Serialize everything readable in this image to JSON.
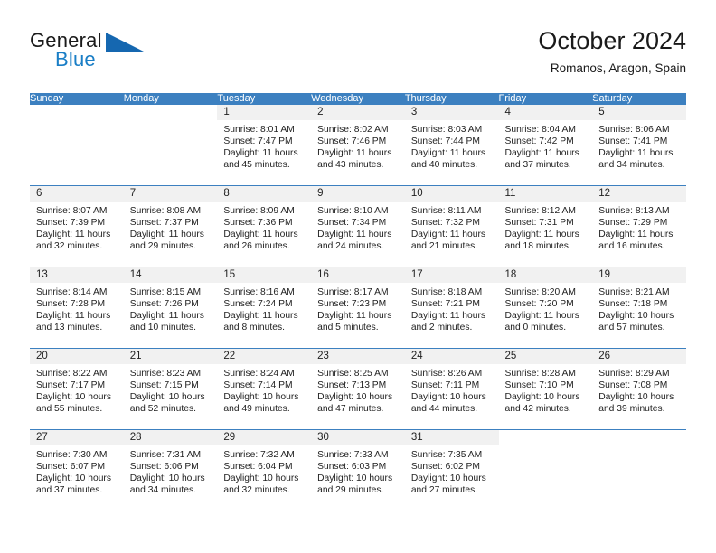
{
  "brand": {
    "line1": "General",
    "line2": "Blue",
    "triangle_color": "#1567b0",
    "blue_color": "#1a7ec6"
  },
  "header": {
    "title": "October 2024",
    "subtitle": "Romanos, Aragon, Spain"
  },
  "theme": {
    "header_bg": "#3c80c0",
    "daynum_bg": "#f1f1f1",
    "separator": "#3c80c0"
  },
  "calendar": {
    "weekday_headers": [
      "Sunday",
      "Monday",
      "Tuesday",
      "Wednesday",
      "Thursday",
      "Friday",
      "Saturday"
    ],
    "weeks": [
      [
        {
          "day": "",
          "sunrise": "",
          "sunset": "",
          "daylight_line1": "",
          "daylight_line2": "",
          "blank": true
        },
        {
          "day": "",
          "sunrise": "",
          "sunset": "",
          "daylight_line1": "",
          "daylight_line2": "",
          "blank": true
        },
        {
          "day": "1",
          "sunrise": "Sunrise: 8:01 AM",
          "sunset": "Sunset: 7:47 PM",
          "daylight_line1": "Daylight: 11 hours",
          "daylight_line2": "and 45 minutes."
        },
        {
          "day": "2",
          "sunrise": "Sunrise: 8:02 AM",
          "sunset": "Sunset: 7:46 PM",
          "daylight_line1": "Daylight: 11 hours",
          "daylight_line2": "and 43 minutes."
        },
        {
          "day": "3",
          "sunrise": "Sunrise: 8:03 AM",
          "sunset": "Sunset: 7:44 PM",
          "daylight_line1": "Daylight: 11 hours",
          "daylight_line2": "and 40 minutes."
        },
        {
          "day": "4",
          "sunrise": "Sunrise: 8:04 AM",
          "sunset": "Sunset: 7:42 PM",
          "daylight_line1": "Daylight: 11 hours",
          "daylight_line2": "and 37 minutes."
        },
        {
          "day": "5",
          "sunrise": "Sunrise: 8:06 AM",
          "sunset": "Sunset: 7:41 PM",
          "daylight_line1": "Daylight: 11 hours",
          "daylight_line2": "and 34 minutes."
        }
      ],
      [
        {
          "day": "6",
          "sunrise": "Sunrise: 8:07 AM",
          "sunset": "Sunset: 7:39 PM",
          "daylight_line1": "Daylight: 11 hours",
          "daylight_line2": "and 32 minutes."
        },
        {
          "day": "7",
          "sunrise": "Sunrise: 8:08 AM",
          "sunset": "Sunset: 7:37 PM",
          "daylight_line1": "Daylight: 11 hours",
          "daylight_line2": "and 29 minutes."
        },
        {
          "day": "8",
          "sunrise": "Sunrise: 8:09 AM",
          "sunset": "Sunset: 7:36 PM",
          "daylight_line1": "Daylight: 11 hours",
          "daylight_line2": "and 26 minutes."
        },
        {
          "day": "9",
          "sunrise": "Sunrise: 8:10 AM",
          "sunset": "Sunset: 7:34 PM",
          "daylight_line1": "Daylight: 11 hours",
          "daylight_line2": "and 24 minutes."
        },
        {
          "day": "10",
          "sunrise": "Sunrise: 8:11 AM",
          "sunset": "Sunset: 7:32 PM",
          "daylight_line1": "Daylight: 11 hours",
          "daylight_line2": "and 21 minutes."
        },
        {
          "day": "11",
          "sunrise": "Sunrise: 8:12 AM",
          "sunset": "Sunset: 7:31 PM",
          "daylight_line1": "Daylight: 11 hours",
          "daylight_line2": "and 18 minutes."
        },
        {
          "day": "12",
          "sunrise": "Sunrise: 8:13 AM",
          "sunset": "Sunset: 7:29 PM",
          "daylight_line1": "Daylight: 11 hours",
          "daylight_line2": "and 16 minutes."
        }
      ],
      [
        {
          "day": "13",
          "sunrise": "Sunrise: 8:14 AM",
          "sunset": "Sunset: 7:28 PM",
          "daylight_line1": "Daylight: 11 hours",
          "daylight_line2": "and 13 minutes."
        },
        {
          "day": "14",
          "sunrise": "Sunrise: 8:15 AM",
          "sunset": "Sunset: 7:26 PM",
          "daylight_line1": "Daylight: 11 hours",
          "daylight_line2": "and 10 minutes."
        },
        {
          "day": "15",
          "sunrise": "Sunrise: 8:16 AM",
          "sunset": "Sunset: 7:24 PM",
          "daylight_line1": "Daylight: 11 hours",
          "daylight_line2": "and 8 minutes."
        },
        {
          "day": "16",
          "sunrise": "Sunrise: 8:17 AM",
          "sunset": "Sunset: 7:23 PM",
          "daylight_line1": "Daylight: 11 hours",
          "daylight_line2": "and 5 minutes."
        },
        {
          "day": "17",
          "sunrise": "Sunrise: 8:18 AM",
          "sunset": "Sunset: 7:21 PM",
          "daylight_line1": "Daylight: 11 hours",
          "daylight_line2": "and 2 minutes."
        },
        {
          "day": "18",
          "sunrise": "Sunrise: 8:20 AM",
          "sunset": "Sunset: 7:20 PM",
          "daylight_line1": "Daylight: 11 hours",
          "daylight_line2": "and 0 minutes."
        },
        {
          "day": "19",
          "sunrise": "Sunrise: 8:21 AM",
          "sunset": "Sunset: 7:18 PM",
          "daylight_line1": "Daylight: 10 hours",
          "daylight_line2": "and 57 minutes."
        }
      ],
      [
        {
          "day": "20",
          "sunrise": "Sunrise: 8:22 AM",
          "sunset": "Sunset: 7:17 PM",
          "daylight_line1": "Daylight: 10 hours",
          "daylight_line2": "and 55 minutes."
        },
        {
          "day": "21",
          "sunrise": "Sunrise: 8:23 AM",
          "sunset": "Sunset: 7:15 PM",
          "daylight_line1": "Daylight: 10 hours",
          "daylight_line2": "and 52 minutes."
        },
        {
          "day": "22",
          "sunrise": "Sunrise: 8:24 AM",
          "sunset": "Sunset: 7:14 PM",
          "daylight_line1": "Daylight: 10 hours",
          "daylight_line2": "and 49 minutes."
        },
        {
          "day": "23",
          "sunrise": "Sunrise: 8:25 AM",
          "sunset": "Sunset: 7:13 PM",
          "daylight_line1": "Daylight: 10 hours",
          "daylight_line2": "and 47 minutes."
        },
        {
          "day": "24",
          "sunrise": "Sunrise: 8:26 AM",
          "sunset": "Sunset: 7:11 PM",
          "daylight_line1": "Daylight: 10 hours",
          "daylight_line2": "and 44 minutes."
        },
        {
          "day": "25",
          "sunrise": "Sunrise: 8:28 AM",
          "sunset": "Sunset: 7:10 PM",
          "daylight_line1": "Daylight: 10 hours",
          "daylight_line2": "and 42 minutes."
        },
        {
          "day": "26",
          "sunrise": "Sunrise: 8:29 AM",
          "sunset": "Sunset: 7:08 PM",
          "daylight_line1": "Daylight: 10 hours",
          "daylight_line2": "and 39 minutes."
        }
      ],
      [
        {
          "day": "27",
          "sunrise": "Sunrise: 7:30 AM",
          "sunset": "Sunset: 6:07 PM",
          "daylight_line1": "Daylight: 10 hours",
          "daylight_line2": "and 37 minutes."
        },
        {
          "day": "28",
          "sunrise": "Sunrise: 7:31 AM",
          "sunset": "Sunset: 6:06 PM",
          "daylight_line1": "Daylight: 10 hours",
          "daylight_line2": "and 34 minutes."
        },
        {
          "day": "29",
          "sunrise": "Sunrise: 7:32 AM",
          "sunset": "Sunset: 6:04 PM",
          "daylight_line1": "Daylight: 10 hours",
          "daylight_line2": "and 32 minutes."
        },
        {
          "day": "30",
          "sunrise": "Sunrise: 7:33 AM",
          "sunset": "Sunset: 6:03 PM",
          "daylight_line1": "Daylight: 10 hours",
          "daylight_line2": "and 29 minutes."
        },
        {
          "day": "31",
          "sunrise": "Sunrise: 7:35 AM",
          "sunset": "Sunset: 6:02 PM",
          "daylight_line1": "Daylight: 10 hours",
          "daylight_line2": "and 27 minutes."
        },
        {
          "day": "",
          "sunrise": "",
          "sunset": "",
          "daylight_line1": "",
          "daylight_line2": "",
          "blank": true
        },
        {
          "day": "",
          "sunrise": "",
          "sunset": "",
          "daylight_line1": "",
          "daylight_line2": "",
          "blank": true
        }
      ]
    ]
  }
}
